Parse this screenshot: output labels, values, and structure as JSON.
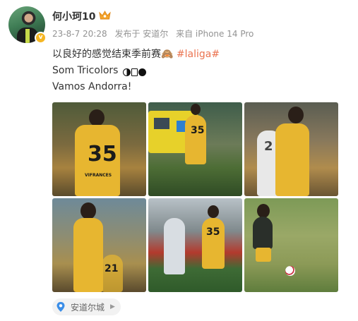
{
  "user": {
    "name": "何小珂10",
    "verified_badge": "v"
  },
  "meta": {
    "time": "23-8-7 20:28",
    "published_at": "发布于 安道尔",
    "source": "来自 iPhone 14 Pro"
  },
  "post": {
    "line1_text": "以良好的感觉结束季前赛",
    "line1_emoji": "🙈",
    "hashtag": "#laliga#",
    "line2_text": "Som Tricolors",
    "line3_text": "Vamos Andorra!"
  },
  "photos": [
    {
      "number": "35",
      "sponsor": "VIFRANCES"
    },
    {
      "number": "35"
    },
    {
      "number": "2"
    },
    {
      "number": "21"
    },
    {
      "number": "35"
    },
    {
      "number": ""
    }
  ],
  "location": {
    "label": "安道尔城"
  },
  "colors": {
    "hashtag": "#eb7350",
    "kit_yellow": "#e7b630",
    "meta_gray": "#939393"
  }
}
